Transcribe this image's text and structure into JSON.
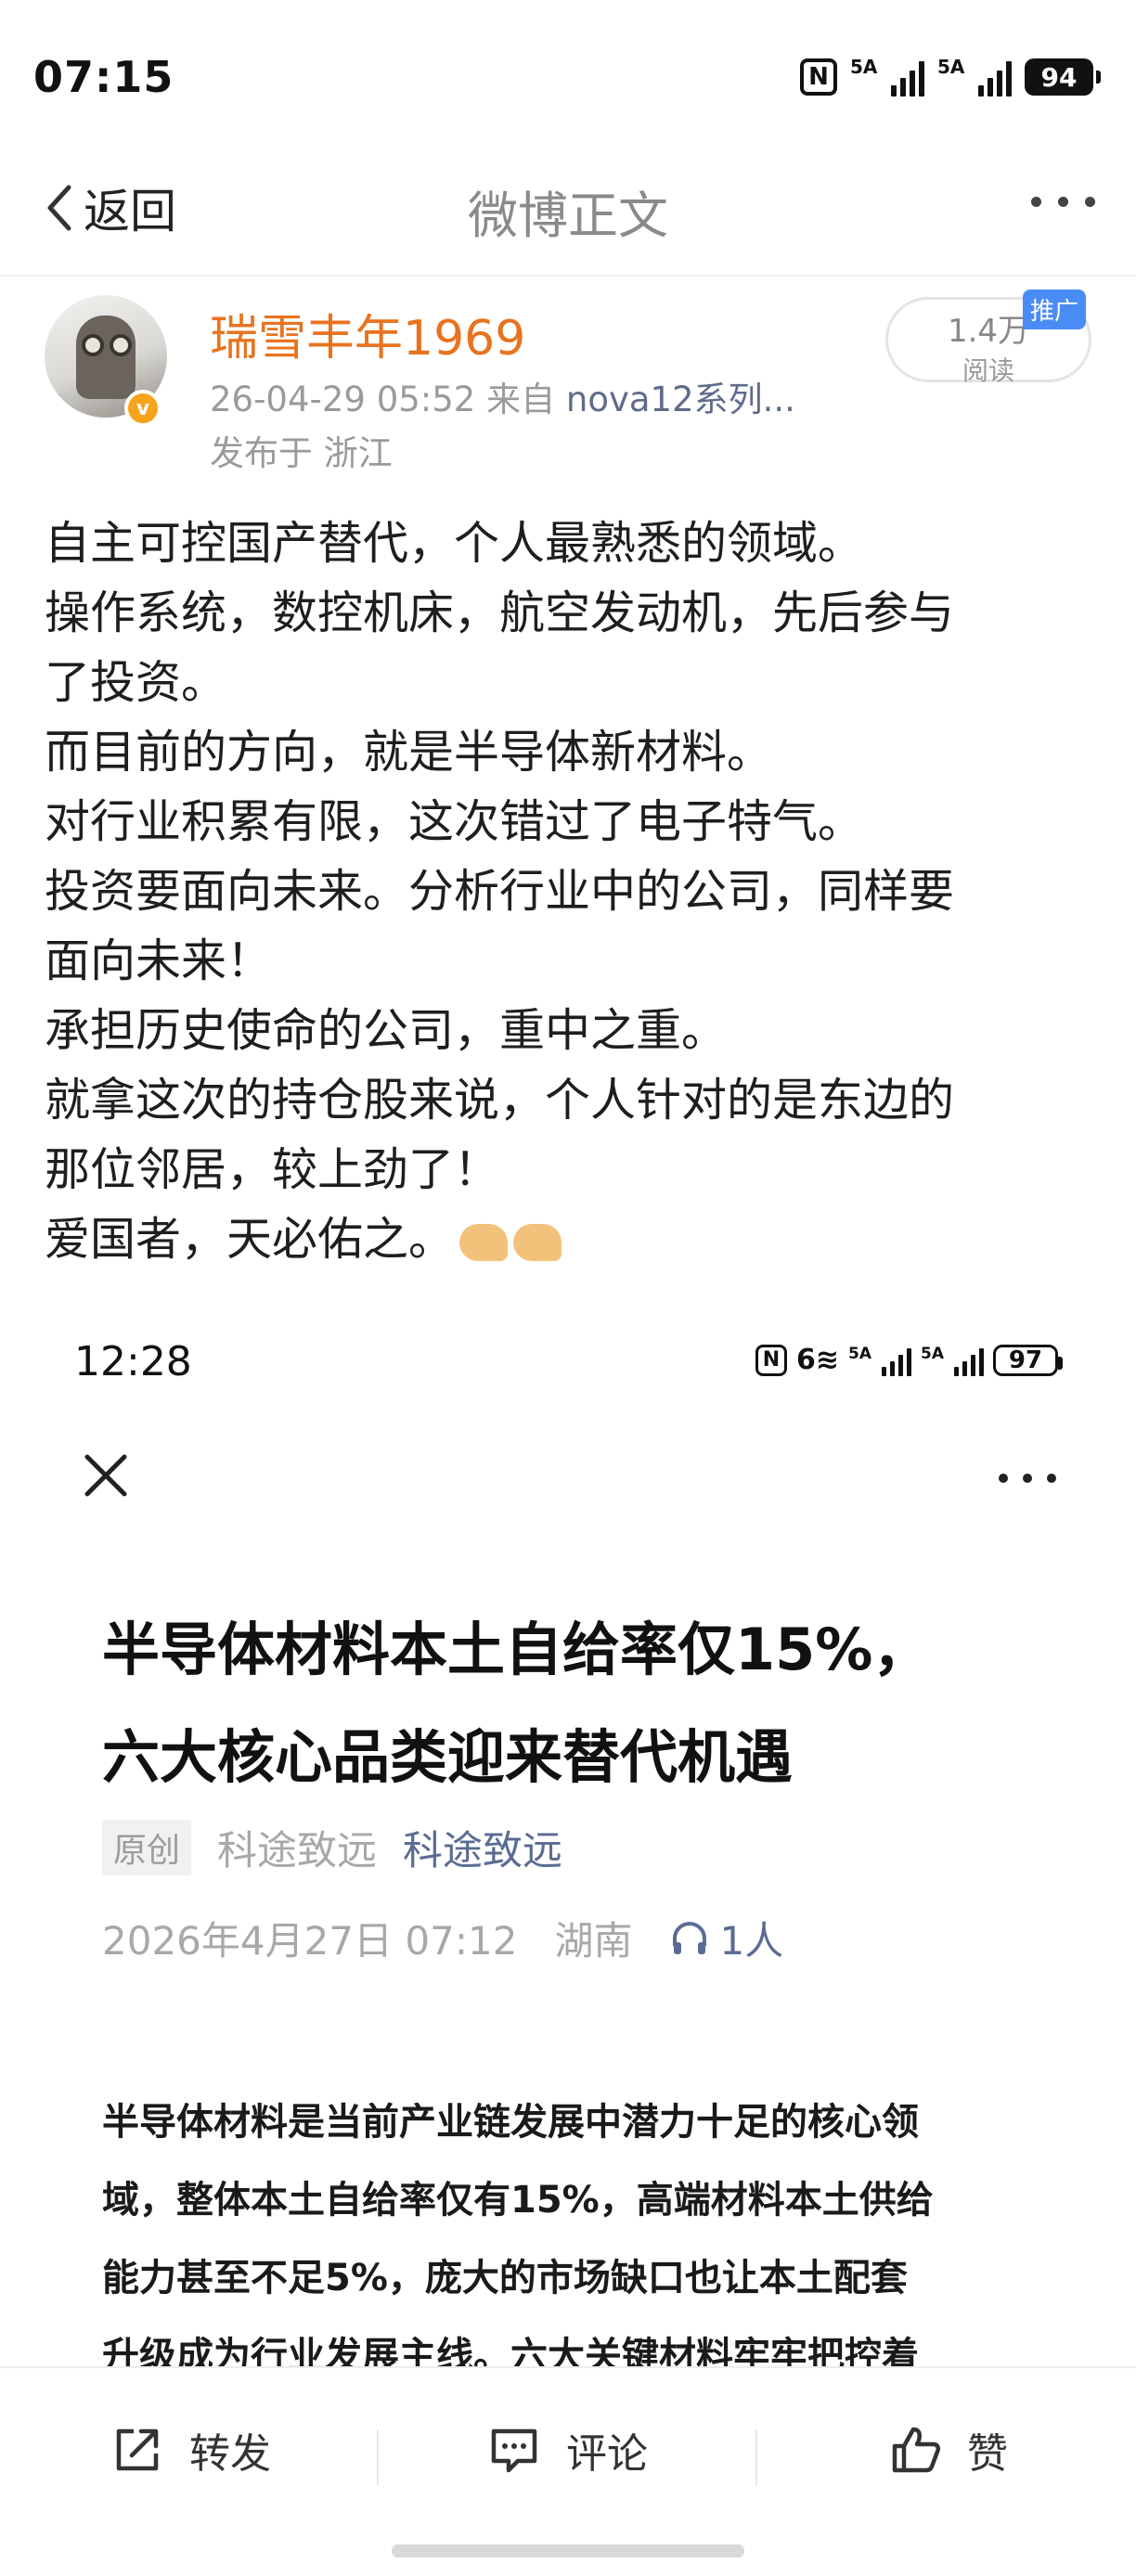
{
  "status_bar": {
    "time": "07:15",
    "nfc": "N",
    "sim1": "5A",
    "sim2": "5A",
    "battery": "94"
  },
  "nav": {
    "back_label": "返回",
    "title": "微博正文"
  },
  "post": {
    "author": "瑞雪丰年1969",
    "timestamp": "26-04-29 05:52",
    "source_prefix": "来自",
    "source": "nova12系列...",
    "location": "发布于 浙江",
    "reads_count": "1.4万",
    "reads_label": "阅读",
    "promo_tag": "推广",
    "verified_badge": "v",
    "lines": [
      "自主可控国产替代，个人最熟悉的领域。",
      "操作系统，数控机床，航空发动机，先后参与",
      "了投资。",
      "而目前的方向，就是半导体新材料。",
      "对行业积累有限，这次错过了电子特气。",
      "投资要面向未来。分析行业中的公司，同样要",
      "面向未来！",
      "承担历史使命的公司，重中之重。",
      "就拿这次的持仓股来说，个人针对的是东边的",
      "那位邻居，较上劲了！",
      "爱国者，天必佑之。"
    ],
    "emoji": "folded-hands-emoji"
  },
  "embedded_screenshot": {
    "status_time": "12:28",
    "nfc": "N",
    "wifi": "6",
    "sim1": "5A",
    "sim2": "5A",
    "battery": "97",
    "headline_lines": [
      "半导体材料本土自给率仅15%，",
      "六大核心品类迎来替代机遇"
    ],
    "tag": "原创",
    "source_name": "科途致远",
    "follow_name": "科途致远",
    "date": "2026年4月27日 07:12",
    "region": "湖南",
    "listeners": "1人",
    "paragraph_lines": [
      "半导体材料是当前产业链发展中潜力十足的核心领",
      "域，整体本土自给率仅有15%，高端材料本土供给",
      "能力甚至不足5%，庞大的市场缺口也让本土配套",
      "升级成为行业发展主线。六大关键材料牢牢把控着"
    ]
  },
  "bottom_bar": {
    "repost": "转发",
    "comment": "评论",
    "like": "赞"
  },
  "colors": {
    "author_name": "#e8731f",
    "link_blue": "#5e6c8a",
    "promo_blue": "#4a8cf5",
    "verified_orange": "#f7a21b"
  }
}
